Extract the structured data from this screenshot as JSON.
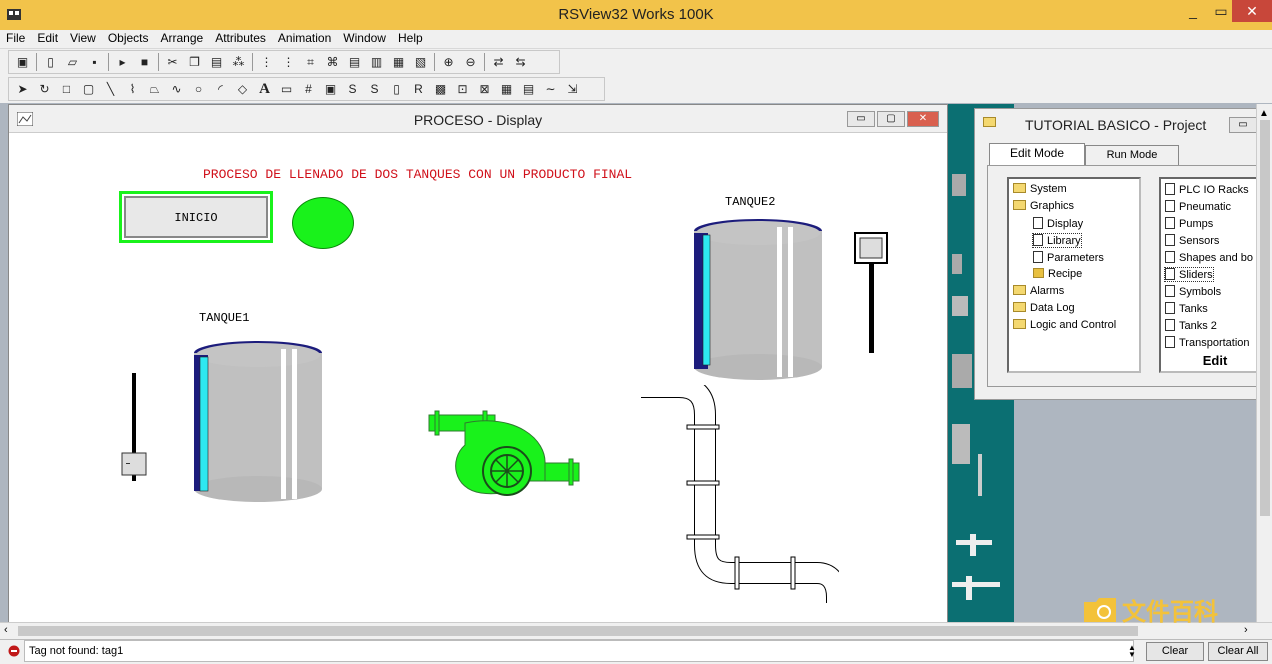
{
  "app": {
    "title": "RSView32 Works 100K",
    "window_controls": [
      "_",
      "▭",
      "✕"
    ]
  },
  "menu": [
    "File",
    "Edit",
    "View",
    "Objects",
    "Arrange",
    "Attributes",
    "Animation",
    "Window",
    "Help"
  ],
  "display_window": {
    "title": "PROCESO - Display",
    "controls": [
      "▭",
      "▢",
      "✕"
    ]
  },
  "canvas": {
    "heading": "PROCESO DE LLENADO DE DOS TANQUES CON UN PRODUCTO FINAL",
    "button_label": "INICIO",
    "tank1_label": "TANQUE1",
    "tank2_label": "TANQUE2",
    "heading_color": "#d0101a",
    "indicator_color": "#19f21b",
    "tank_color": "#c0c0c0",
    "level_color": "#2ee8f0"
  },
  "project": {
    "title": "TUTORIAL BASICO - Project",
    "tabs": [
      "Edit Mode",
      "Run Mode"
    ],
    "tree": [
      "System",
      "Graphics",
      "Display",
      "Library",
      "Parameters",
      "Recipe",
      "Alarms",
      "Data Log",
      "Logic and Control"
    ],
    "libraries": [
      "PLC IO Racks",
      "Pneumatic",
      "Pumps",
      "Sensors",
      "Shapes and bo",
      "Sliders",
      "Symbols",
      "Tanks",
      "Tanks 2",
      "Transportation"
    ],
    "edit_label": "Edit"
  },
  "status": {
    "message": "Tag not found: tag1",
    "clear": "Clear",
    "clear_all": "Clear All"
  },
  "watermark": {
    "text": "文件百科"
  }
}
